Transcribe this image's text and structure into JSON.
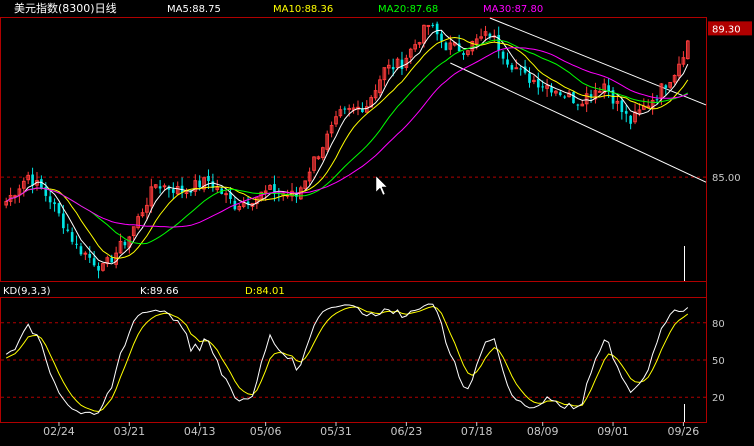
{
  "header": {
    "title": "美元指数(8300)日线",
    "ma5": "MA5:88.75",
    "ma10": "MA10:88.36",
    "ma20": "MA20:87.68",
    "ma30": "MA30:87.80"
  },
  "kd_header": {
    "name": "KD(9,3,3)",
    "k": "K:89.66",
    "d": "D:84.01"
  },
  "colors": {
    "up": "#ff3b3b",
    "down": "#00e5e5",
    "ma5": "#ffffff",
    "ma10": "#ffff00",
    "ma20": "#00ff00",
    "ma30": "#ff00ff",
    "grid_line": "#b00000",
    "axis_label": "#c8c8c8",
    "price_box_bg": "#b00000"
  },
  "chart_data": {
    "type": "candlestick",
    "price_panel": {
      "ylim": [
        82.0,
        89.6
      ],
      "ref_price_label": "85.00",
      "ref_price": 85.0,
      "last_price_label": "89.30",
      "last_price": 89.3
    },
    "kd_panel": {
      "ylim": [
        0,
        100
      ],
      "ticks": [
        80,
        50,
        20
      ],
      "tick_labels": [
        "80",
        "50",
        "20"
      ]
    },
    "date_labels": [
      "02/24",
      "03/21",
      "04/13",
      "05/06",
      "05/31",
      "06/23",
      "07/18",
      "08/09",
      "09/01",
      "09/26"
    ],
    "num_bars": 156,
    "close_anchors": [
      [
        0,
        84.3
      ],
      [
        5,
        85.05
      ],
      [
        10,
        84.35
      ],
      [
        16,
        83.0
      ],
      [
        22,
        82.35
      ],
      [
        28,
        83.3
      ],
      [
        34,
        84.8
      ],
      [
        40,
        84.6
      ],
      [
        46,
        84.9
      ],
      [
        52,
        84.2
      ],
      [
        60,
        84.6
      ],
      [
        66,
        84.45
      ],
      [
        70,
        85.5
      ],
      [
        76,
        86.8
      ],
      [
        82,
        87.1
      ],
      [
        86,
        88.1
      ],
      [
        90,
        88.3
      ],
      [
        96,
        89.4
      ],
      [
        100,
        88.8
      ],
      [
        104,
        88.7
      ],
      [
        110,
        89.15
      ],
      [
        114,
        88.4
      ],
      [
        118,
        87.9
      ],
      [
        124,
        87.6
      ],
      [
        130,
        87.2
      ],
      [
        136,
        87.7
      ],
      [
        140,
        86.9
      ],
      [
        142,
        86.6
      ],
      [
        148,
        87.4
      ],
      [
        152,
        88.05
      ],
      [
        155,
        88.9
      ]
    ],
    "series": [
      {
        "name": "MA5",
        "period": 5
      },
      {
        "name": "MA10",
        "period": 10
      },
      {
        "name": "MA20",
        "period": 20
      },
      {
        "name": "MA30",
        "period": 30
      }
    ],
    "channel": {
      "upper": [
        [
          110,
          89.6
        ],
        [
          155,
          87.3
        ]
      ],
      "lower": [
        [
          101,
          88.3
        ],
        [
          155,
          85.1
        ]
      ]
    }
  }
}
